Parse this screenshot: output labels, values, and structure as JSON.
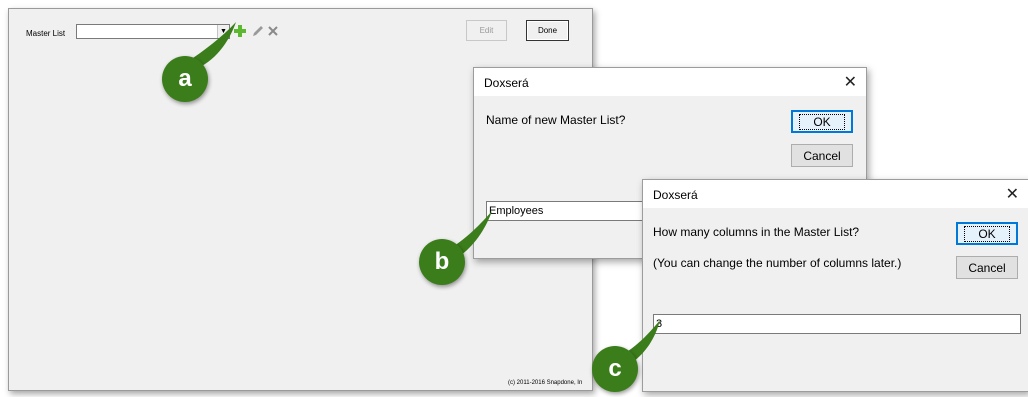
{
  "main_window": {
    "master_list_label": "Master List",
    "master_list_value": "",
    "edit_label": "Edit",
    "done_label": "Done",
    "copyright": "(c) 2011-2016 Snapdone, In"
  },
  "dialog_name": {
    "title": "Doxserá",
    "prompt": "Name of new Master List?",
    "ok_label": "OK",
    "cancel_label": "Cancel",
    "input_value": "Employees"
  },
  "dialog_columns": {
    "title": "Doxserá",
    "prompt_line1": "How many columns in the Master List?",
    "prompt_line2": "(You can change the number of columns later.)",
    "ok_label": "OK",
    "cancel_label": "Cancel",
    "input_value": "3"
  },
  "callouts": {
    "a": "a",
    "b": "b",
    "c": "c"
  },
  "colors": {
    "callout": "#3b7d1b",
    "add_icon": "#5cb82e",
    "default_button_border": "#0078d7"
  },
  "icons": {
    "add": "add-icon",
    "edit": "pencil-icon",
    "delete": "delete-icon",
    "close": "close-icon"
  }
}
